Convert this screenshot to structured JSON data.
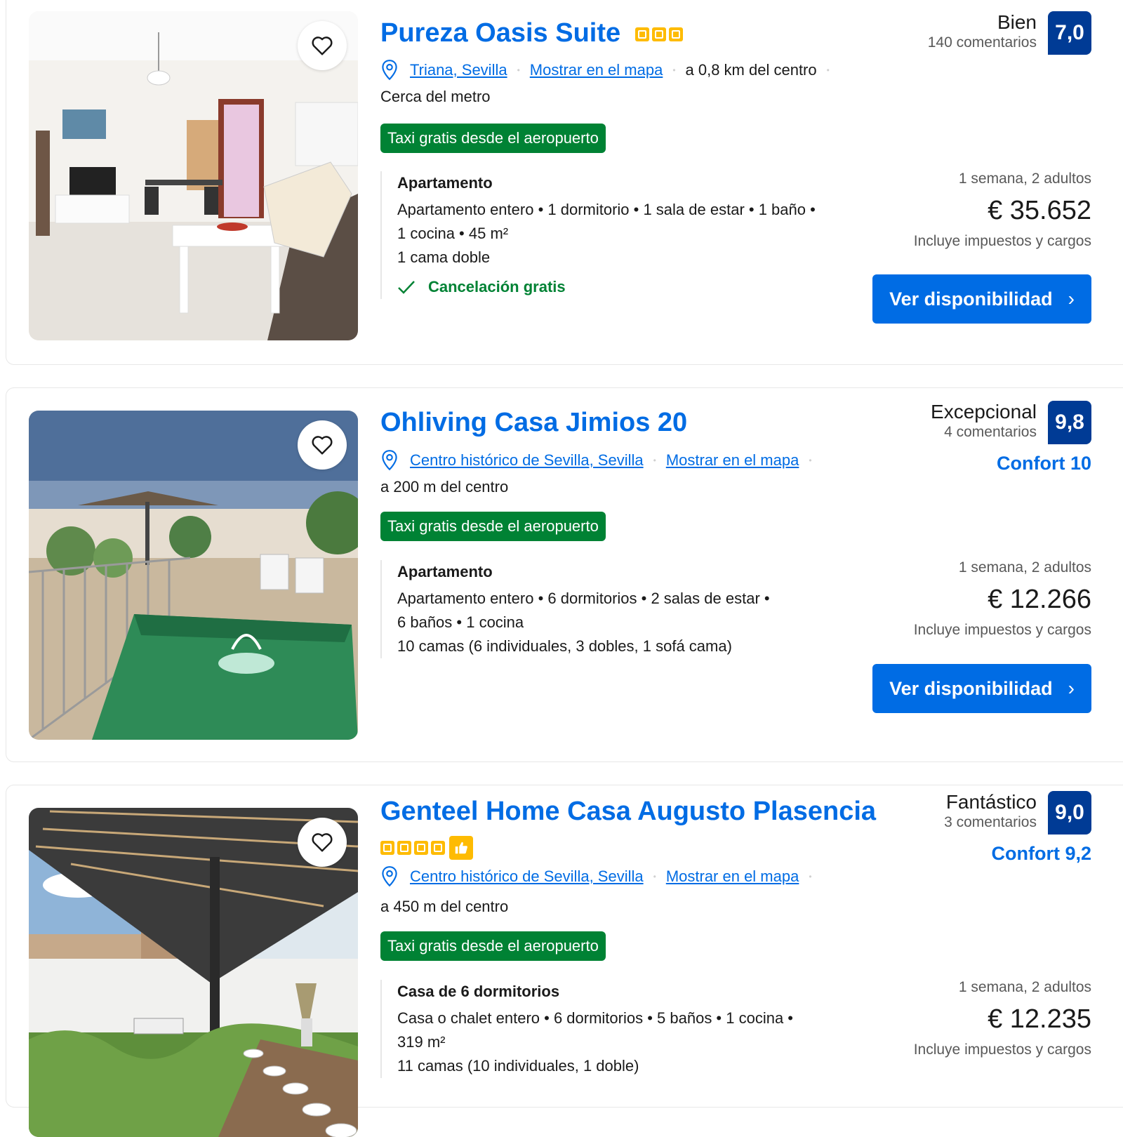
{
  "listings": [
    {
      "title": "Pureza Oasis Suite",
      "stars": 3,
      "location": "Triana, Sevilla",
      "map_link": "Mostrar en el mapa",
      "distance": "a 0,8 km del centro",
      "extra": "Cerca del metro",
      "badge": "Taxi gratis desde el aeropuerto",
      "unit_type": "Apartamento",
      "unit_desc_1": "Apartamento entero • 1 dormitorio • 1 sala de estar • 1 baño •",
      "unit_desc_2": "1 cocina • 45 m²",
      "beds": "1 cama doble",
      "cancellation": "Cancelación gratis",
      "rating_word": "Bien",
      "reviews": "140 comentarios",
      "score": "7,0",
      "nights": "1 semana, 2 adultos",
      "price": "€ 35.652",
      "taxes": "Incluye impuestos y cargos",
      "cta": "Ver disponibilidad"
    },
    {
      "title": "Ohliving Casa Jimios 20",
      "location": "Centro histórico de Sevilla, Sevilla",
      "map_link": "Mostrar en el mapa",
      "distance": "a 200 m del centro",
      "badge": "Taxi gratis desde el aeropuerto",
      "unit_type": "Apartamento",
      "unit_desc_1": "Apartamento entero • 6 dormitorios • 2 salas de estar •",
      "unit_desc_2": "6 baños • 1 cocina",
      "beds": "10 camas (6 individuales, 3 dobles, 1 sofá cama)",
      "rating_word": "Excepcional",
      "reviews": "4 comentarios",
      "score": "9,8",
      "comfort": "Confort 10",
      "nights": "1 semana, 2 adultos",
      "price": "€ 12.266",
      "taxes": "Incluye impuestos y cargos",
      "cta": "Ver disponibilidad"
    },
    {
      "title": "Genteel Home Casa Augusto Plasencia",
      "stars": 4,
      "location": "Centro histórico de Sevilla, Sevilla",
      "map_link": "Mostrar en el mapa",
      "distance": "a 450 m del centro",
      "badge": "Taxi gratis desde el aeropuerto",
      "unit_type": "Casa de 6 dormitorios",
      "unit_desc_1": "Casa o chalet entero • 6 dormitorios • 5 baños • 1 cocina •",
      "unit_desc_2": "319 m²",
      "beds": "11 camas (10 individuales, 1 doble)",
      "rating_word": "Fantástico",
      "reviews": "3 comentarios",
      "score": "9,0",
      "comfort": "Confort 9,2",
      "nights": "1 semana, 2 adultos",
      "price": "€ 12.235",
      "taxes": "Incluye impuestos y cargos"
    }
  ],
  "colors": {
    "brand_blue": "#006ce4",
    "score_blue": "#003b95",
    "green": "#008234",
    "star_yellow": "#febb02"
  },
  "icons": [
    "heart-icon",
    "map-pin-icon",
    "check-icon",
    "chevron-right-icon",
    "thumbs-up-icon",
    "star-icon"
  ]
}
